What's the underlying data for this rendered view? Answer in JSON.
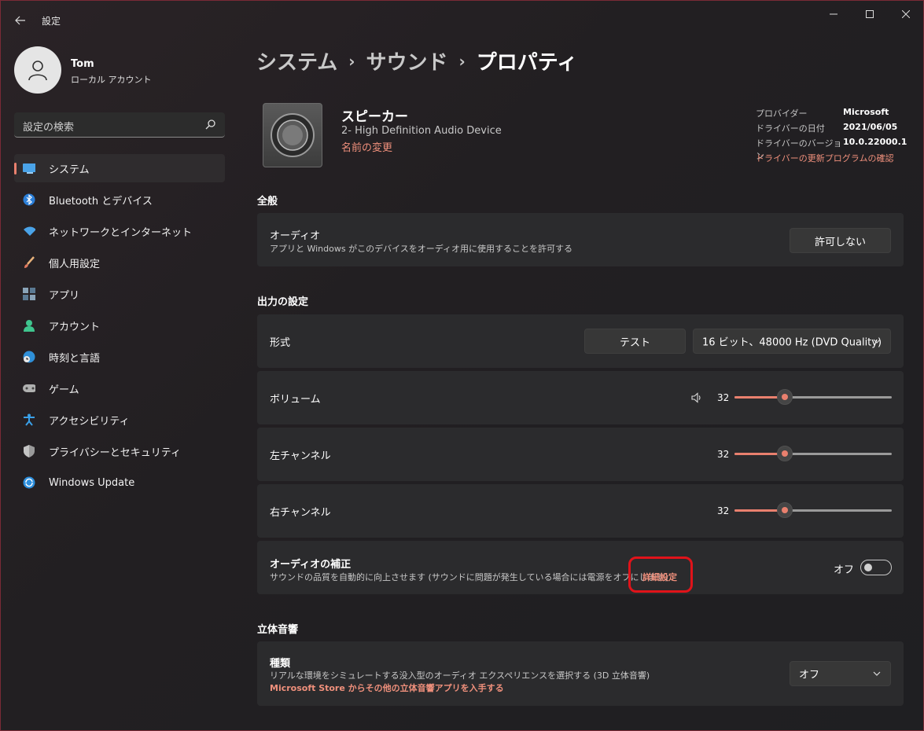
{
  "window": {
    "app_title": "設定"
  },
  "profile": {
    "name": "Tom",
    "account_type": "ローカル アカウント"
  },
  "search": {
    "placeholder": "設定の検索"
  },
  "sidebar": {
    "items": [
      {
        "label": "システム",
        "icon": "system-icon",
        "active": true
      },
      {
        "label": "Bluetooth とデバイス",
        "icon": "bluetooth-icon"
      },
      {
        "label": "ネットワークとインターネット",
        "icon": "wifi-icon"
      },
      {
        "label": "個人用設定",
        "icon": "brush-icon"
      },
      {
        "label": "アプリ",
        "icon": "apps-icon"
      },
      {
        "label": "アカウント",
        "icon": "account-icon"
      },
      {
        "label": "時刻と言語",
        "icon": "globe-clock-icon"
      },
      {
        "label": "ゲーム",
        "icon": "gamepad-icon"
      },
      {
        "label": "アクセシビリティ",
        "icon": "accessibility-icon"
      },
      {
        "label": "プライバシーとセキュリティ",
        "icon": "shield-icon"
      },
      {
        "label": "Windows Update",
        "icon": "update-icon"
      }
    ]
  },
  "breadcrumb": {
    "items": [
      "システム",
      "サウンド",
      "プロパティ"
    ]
  },
  "device": {
    "name": "スピーカー",
    "description": "2- High Definition Audio Device",
    "rename_link": "名前の変更"
  },
  "driver": {
    "provider_label": "プロバイダー",
    "provider_value": "Microsoft",
    "date_label": "ドライバーの日付",
    "date_value": "2021/06/05",
    "version_label": "ドライバーのバージョン",
    "version_value": "10.0.22000.1",
    "update_link": "ドライバーの更新プログラムの確認"
  },
  "general": {
    "section_title": "全般",
    "audio_title": "オーディオ",
    "audio_desc": "アプリと Windows がこのデバイスをオーディオ用に使用することを許可する",
    "disallow_button": "許可しない"
  },
  "output": {
    "section_title": "出力の設定",
    "format_label": "形式",
    "test_button": "テスト",
    "format_value": "16 ビット、48000 Hz (DVD Quality)",
    "volume_label": "ボリューム",
    "volume_value": "32",
    "left_label": "左チャンネル",
    "left_value": "32",
    "right_label": "右チャンネル",
    "right_value": "32",
    "enhance_title": "オーディオの補正",
    "enhance_desc": "サウンドの品質を自動的に向上させます (サウンドに問題が発生している場合には電源をオフにします)",
    "advanced_link": "詳細設定",
    "enhance_state": "オフ"
  },
  "spatial": {
    "section_title": "立体音響",
    "type_title": "種類",
    "type_desc": "リアルな環境をシミュレートする没入型のオーディオ エクスペリエンスを選択する (3D 立体音響)",
    "store_link": "Microsoft Store からその他の立体音響アプリを入手する",
    "type_value": "オフ"
  },
  "colors": {
    "accent": "#e9806e",
    "link": "#f0907c",
    "highlight_box": "#e0131a"
  }
}
